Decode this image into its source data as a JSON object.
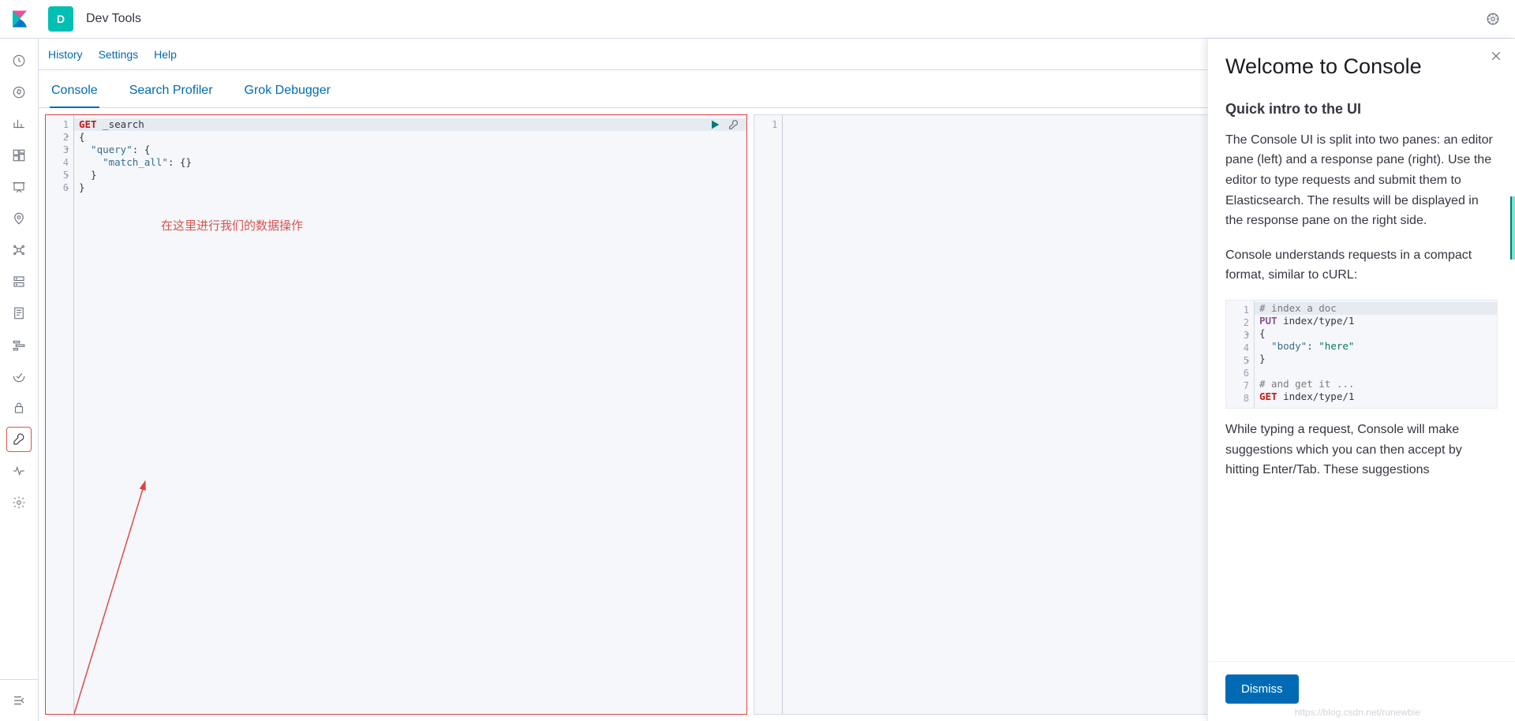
{
  "header": {
    "app_initial": "D",
    "app_title": "Dev Tools"
  },
  "links": {
    "history": "History",
    "settings": "Settings",
    "help": "Help"
  },
  "tabs": {
    "console": "Console",
    "search_profiler": "Search Profiler",
    "grok_debugger": "Grok Debugger"
  },
  "editor": {
    "line_numbers": [
      "1",
      "2",
      "3",
      "4",
      "5",
      "6"
    ],
    "code": {
      "l1_method": "GET",
      "l1_path": " _search",
      "l2": "{",
      "l3a": "  \"query\"",
      "l3b": ": {",
      "l4a": "    \"match_all\"",
      "l4b": ": {}",
      "l5": "  }",
      "l6": "}"
    },
    "annotation": "在这里进行我们的数据操作"
  },
  "response": {
    "line_numbers": [
      "1"
    ]
  },
  "flyout": {
    "title": "Welcome to Console",
    "intro_heading": "Quick intro to the UI",
    "intro_p1": "The Console UI is split into two panes: an editor pane (left) and a response pane (right). Use the editor to type requests and submit them to Elasticsearch. The results will be displayed in the response pane on the right side.",
    "intro_p2": "Console understands requests in a compact format, similar to cURL:",
    "example": {
      "line_numbers": [
        "1",
        "2",
        "3",
        "4",
        "5",
        "6",
        "7",
        "8"
      ],
      "l1": "# index a doc",
      "l2_method": "PUT",
      "l2_path": " index/type/1",
      "l3": "{",
      "l4a": "  \"body\"",
      "l4b": ": ",
      "l4c": "\"here\"",
      "l5": "}",
      "l6": "",
      "l7": "# and get it ...",
      "l8_method": "GET",
      "l8_path": " index/type/1"
    },
    "intro_p3": "While typing a request, Console will make suggestions which you can then accept by hitting Enter/Tab. These suggestions",
    "dismiss": "Dismiss"
  },
  "watermark": "https://blog.csdn.net/runewbie"
}
